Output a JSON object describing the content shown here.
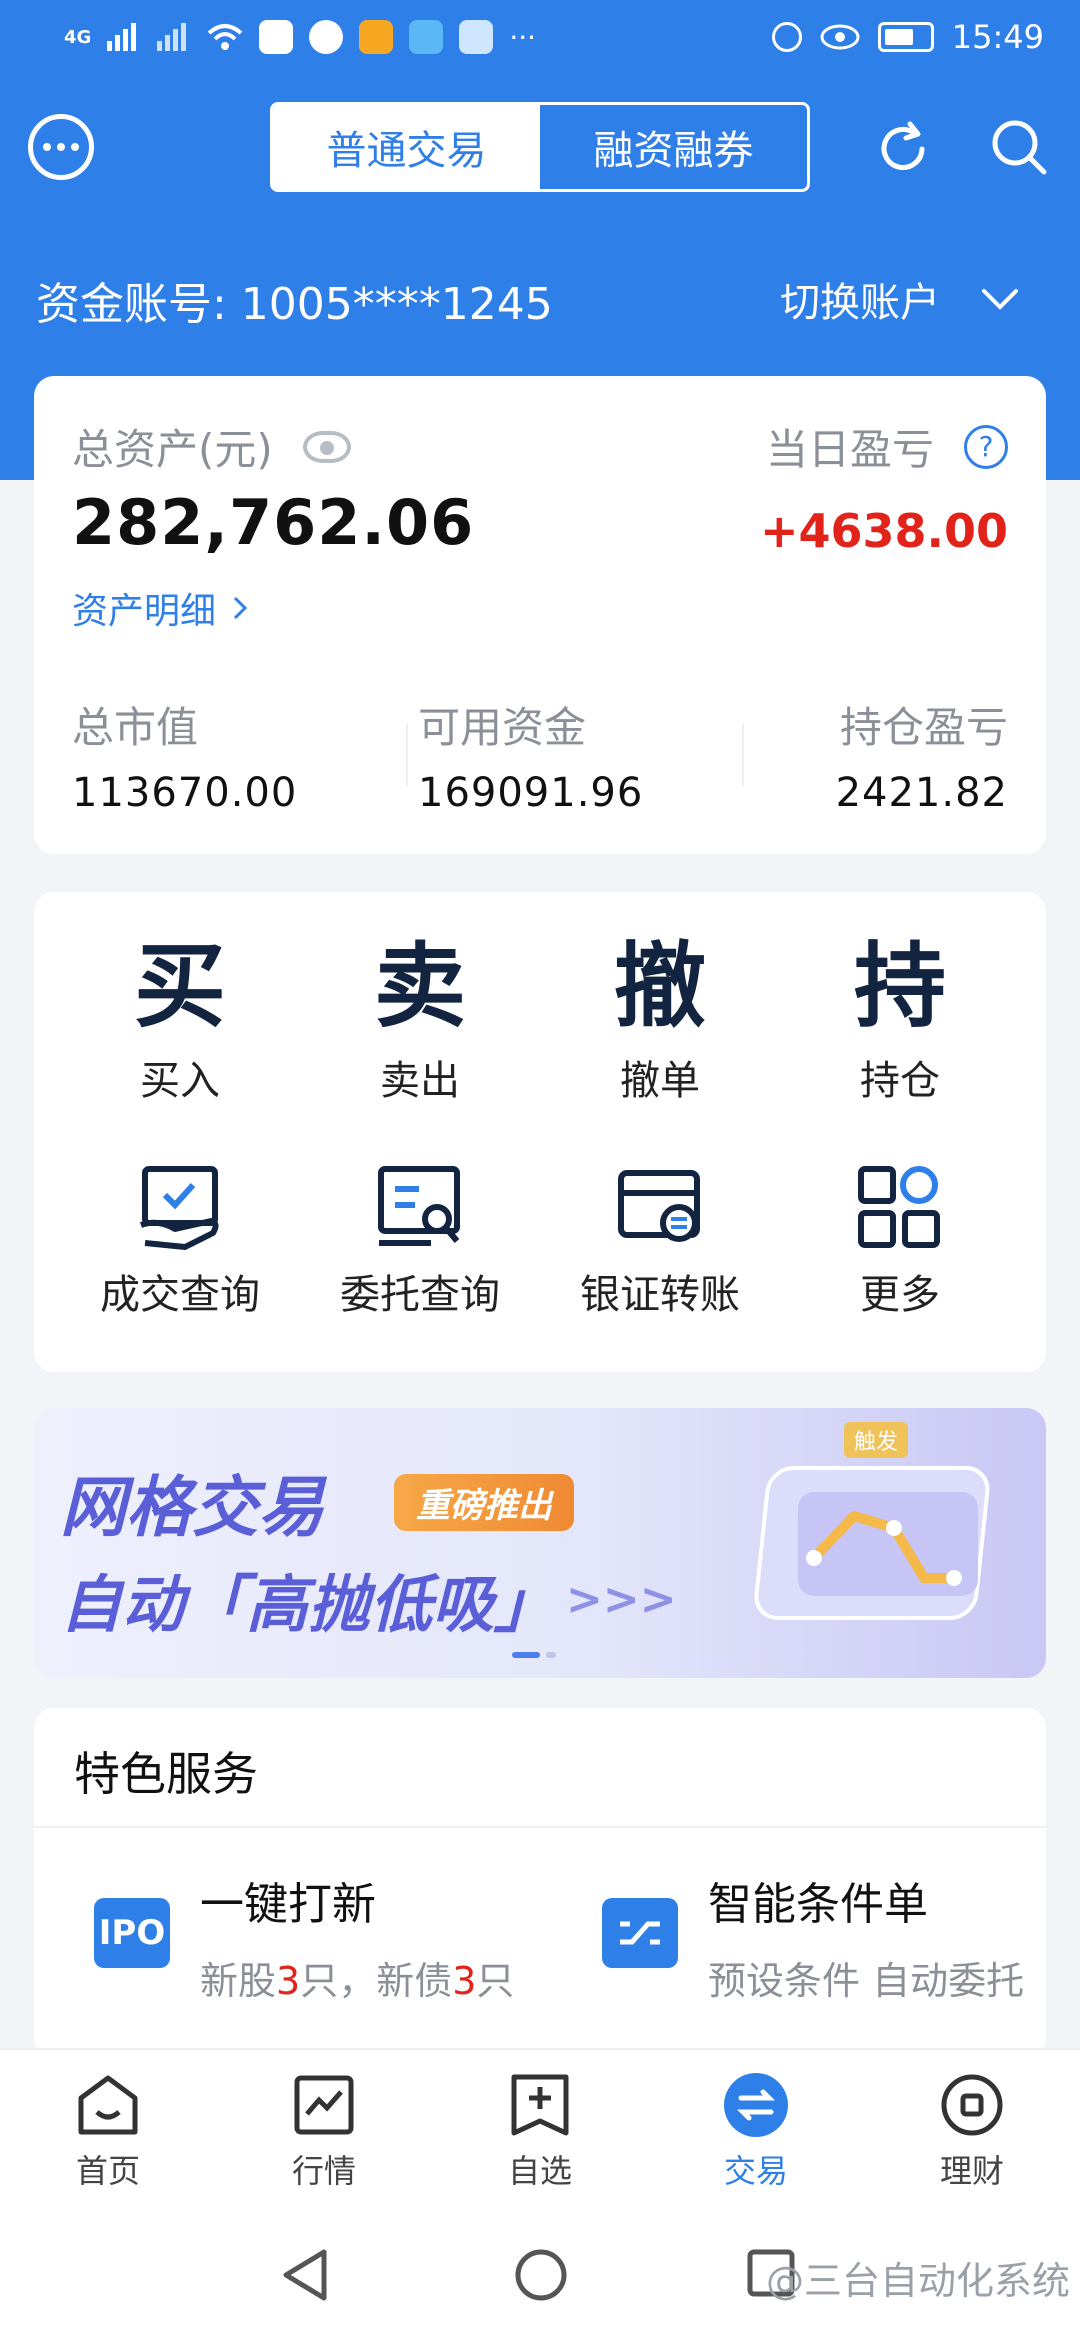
{
  "status_bar": {
    "signal_left": "4G",
    "time": "15:49",
    "more": "···"
  },
  "header": {
    "tabs": [
      {
        "label": "普通交易",
        "active": true
      },
      {
        "label": "融资融券",
        "active": false
      }
    ],
    "account_label": "资金账号: 1005****1245",
    "switch_label": "切换账户"
  },
  "assets": {
    "total_label": "总资产(元)",
    "total_value": "282,762.06",
    "daily_pnl_label": "当日盈亏",
    "daily_pnl_value": "+4638.00",
    "detail_link": "资产明细",
    "stats": [
      {
        "label": "总市值",
        "value": "113670.00"
      },
      {
        "label": "可用资金",
        "value": "169091.96"
      },
      {
        "label": "持仓盈亏",
        "value": "2421.82"
      }
    ]
  },
  "actions": {
    "row1": [
      {
        "char": "买",
        "label": "买入"
      },
      {
        "char": "卖",
        "label": "卖出"
      },
      {
        "char": "撤",
        "label": "撤单"
      },
      {
        "char": "持",
        "label": "持仓"
      }
    ],
    "row2": [
      {
        "icon": "deal-query-icon",
        "label": "成交查询"
      },
      {
        "icon": "order-query-icon",
        "label": "委托查询"
      },
      {
        "icon": "bank-transfer-icon",
        "label": "银证转账"
      },
      {
        "icon": "more-grid-icon",
        "label": "更多"
      }
    ]
  },
  "banner": {
    "title": "网格交易",
    "tag": "重磅推出",
    "subtitle": "自动「高抛低吸」",
    "arrows": ">>>",
    "badge": "触发"
  },
  "services": {
    "title": "特色服务",
    "items": [
      {
        "icon_text": "IPO",
        "name": "一键打新",
        "desc_parts": [
          "新股",
          "3",
          "只，新债",
          "3",
          "只"
        ]
      },
      {
        "icon_text": "",
        "name": "智能条件单",
        "desc": "预设条件 自动委托"
      }
    ]
  },
  "tabbar": [
    {
      "label": "首页",
      "icon": "home-icon",
      "active": false
    },
    {
      "label": "行情",
      "icon": "market-chart-icon",
      "active": false
    },
    {
      "label": "自选",
      "icon": "watchlist-add-icon",
      "active": false
    },
    {
      "label": "交易",
      "icon": "trade-exchange-icon",
      "active": true
    },
    {
      "label": "理财",
      "icon": "wealth-icon",
      "active": false
    }
  ],
  "watermark": "@三台自动化系统",
  "colors": {
    "brand_blue": "#2f7fe8",
    "profit_red": "#e2231a",
    "banner_purple": "#5a5fd8"
  }
}
